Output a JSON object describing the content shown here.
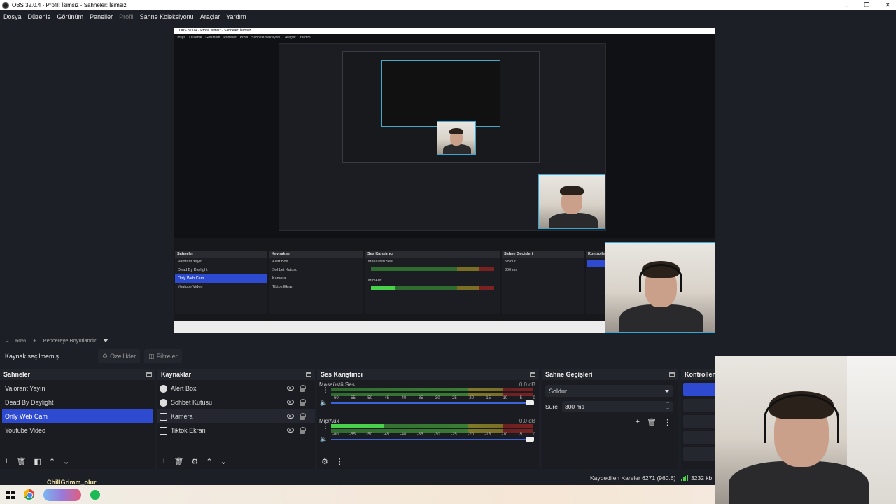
{
  "window": {
    "title": "OBS 32.0.4 - Profil: İsimsiz - Sahneler: İsimsiz",
    "controls": [
      "–",
      "❐",
      "✕"
    ]
  },
  "menu": [
    "Dosya",
    "Düzenle",
    "Görünüm",
    "Paneller",
    "Profil",
    "Sahne Koleksiyonu",
    "Araçlar",
    "Yardım"
  ],
  "scale": {
    "minus": "–",
    "zoom": "60%",
    "plus": "+",
    "fit_label": "Pencereye Boyutlandır"
  },
  "context": {
    "no_source": "Kaynak seçilmemiş",
    "properties": "Özellikler",
    "filters": "Filtreler"
  },
  "scenes": {
    "title": "Sahneler",
    "items": [
      "Valorant Yayın",
      "Dead By Daylight",
      "Only Web Cam",
      "Youtube Video"
    ],
    "selected_index": 2
  },
  "sources": {
    "title": "Kaynaklar",
    "items": [
      {
        "label": "Alert Box",
        "icon": "browser-icon"
      },
      {
        "label": "Sohbet Kutusu",
        "icon": "browser-icon"
      },
      {
        "label": "Kamera",
        "icon": "camera-icon"
      },
      {
        "label": "Tiktok Ekran",
        "icon": "window-capture-icon"
      }
    ]
  },
  "mixer": {
    "title": "Ses Karıştırıcı",
    "channels": [
      {
        "name": "Masaüstü Ses",
        "db": "0.0 dB",
        "level": 0
      },
      {
        "name": "Mic/Aux",
        "db": "0.0 dB",
        "level": 0.26
      }
    ],
    "ticks": [
      "-60",
      "-55",
      "-50",
      "-45",
      "-40",
      "-35",
      "-30",
      "-25",
      "-20",
      "-15",
      "-10",
      "-5",
      "0"
    ]
  },
  "transitions": {
    "title": "Sahne Geçişleri",
    "selected": "Soldur",
    "duration_label": "Süre",
    "duration_value": "300 ms"
  },
  "controls": {
    "title": "Kontroller"
  },
  "status": {
    "dropped_frames": "Kaybedilen Kareler 6271 (960.6)",
    "bitrate": "3232 kb"
  },
  "overlay": {
    "stream_text": "ChillGrimm_olur"
  },
  "nested": {
    "scenes_title": "Sahneler",
    "sources_title": "Kaynaklar",
    "mixer_title": "Ses Karıştırıcı",
    "transitions_title": "Sahne Geçişleri",
    "controls_title": "Kontroller"
  },
  "colors": {
    "background": "#1d1f26",
    "selection": "#2e4ad1",
    "meter_green": "#49d14b",
    "slider_blue": "#3c63d8"
  }
}
